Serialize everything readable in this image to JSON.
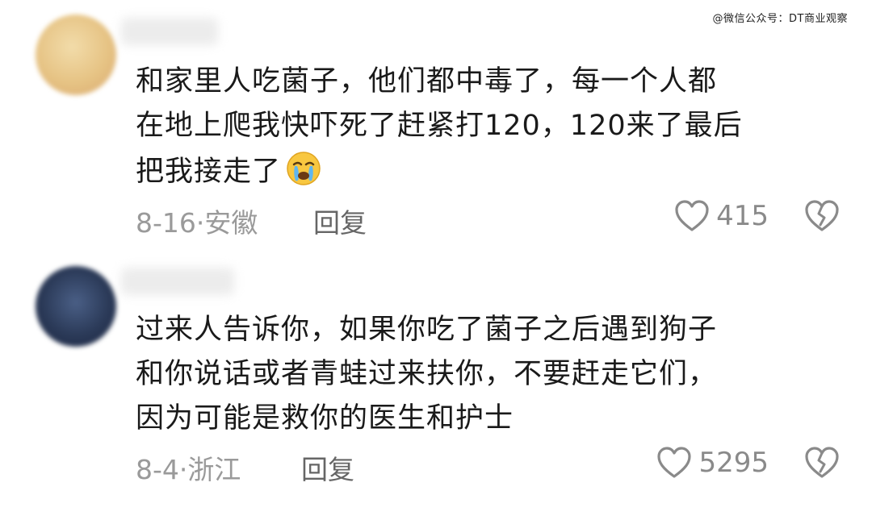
{
  "watermark": "@微信公众号：DT商业观察",
  "comments": [
    {
      "text_lines": [
        "和家里人吃菌子，他们都中毒了，每一个人都",
        "在地上爬我快吓死了赶紧打120，120来了最后",
        "把我接走了"
      ],
      "emoji": "crying-face-emoji",
      "date_location": "8-16·安徽",
      "reply_label": "回复",
      "likes": "415",
      "avatar_color": "#e8c98a"
    },
    {
      "text_lines": [
        "过来人告诉你，如果你吃了菌子之后遇到狗子",
        "和你说话或者青蛙过来扶你，不要赶走它们，",
        "因为可能是救你的医生和护士"
      ],
      "date_location": "8-4·浙江",
      "reply_label": "回复",
      "likes": "5295",
      "avatar_color": "#2b3a58"
    }
  ]
}
